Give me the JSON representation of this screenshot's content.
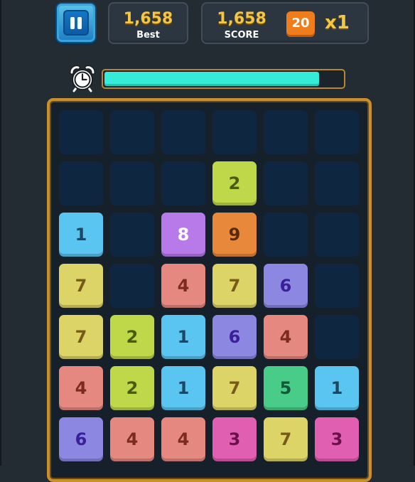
{
  "header": {
    "best_value": "1,658",
    "best_label": "Best",
    "score_value": "1,658",
    "score_label": "SCORE",
    "combo_count": "20",
    "multiplier": "x1",
    "pause_icon": "pause-icon"
  },
  "timer": {
    "icon": "alarm-clock-icon",
    "remaining_fraction": 0.9
  },
  "board": {
    "columns": 6,
    "rows": [
      [
        null,
        null,
        null,
        null,
        null,
        null
      ],
      [
        null,
        null,
        null,
        2,
        null,
        null
      ],
      [
        1,
        null,
        8,
        9,
        null,
        null
      ],
      [
        7,
        null,
        4,
        7,
        6,
        null
      ],
      [
        7,
        2,
        1,
        6,
        4,
        null
      ],
      [
        4,
        2,
        1,
        7,
        5,
        1
      ],
      [
        6,
        4,
        4,
        3,
        7,
        3
      ]
    ],
    "tile_colors": {
      "1": {
        "bg": "#5ac5f0",
        "fg": "#1e4660"
      },
      "2": {
        "bg": "#bfd84a",
        "fg": "#4a5a12"
      },
      "3": {
        "bg": "#e05fb0",
        "fg": "#6a1248"
      },
      "4": {
        "bg": "#e48880",
        "fg": "#7a2c1e"
      },
      "5": {
        "bg": "#48cc88",
        "fg": "#12583a"
      },
      "6": {
        "bg": "#8c88e2",
        "fg": "#3a1e9a"
      },
      "7": {
        "bg": "#dcd466",
        "fg": "#7a5a1a"
      },
      "8": {
        "bg": "#b87ae8",
        "fg": "#ffffff"
      },
      "9": {
        "bg": "#e8883a",
        "fg": "#5a2a08"
      }
    },
    "empty_color": "#0f2640"
  }
}
